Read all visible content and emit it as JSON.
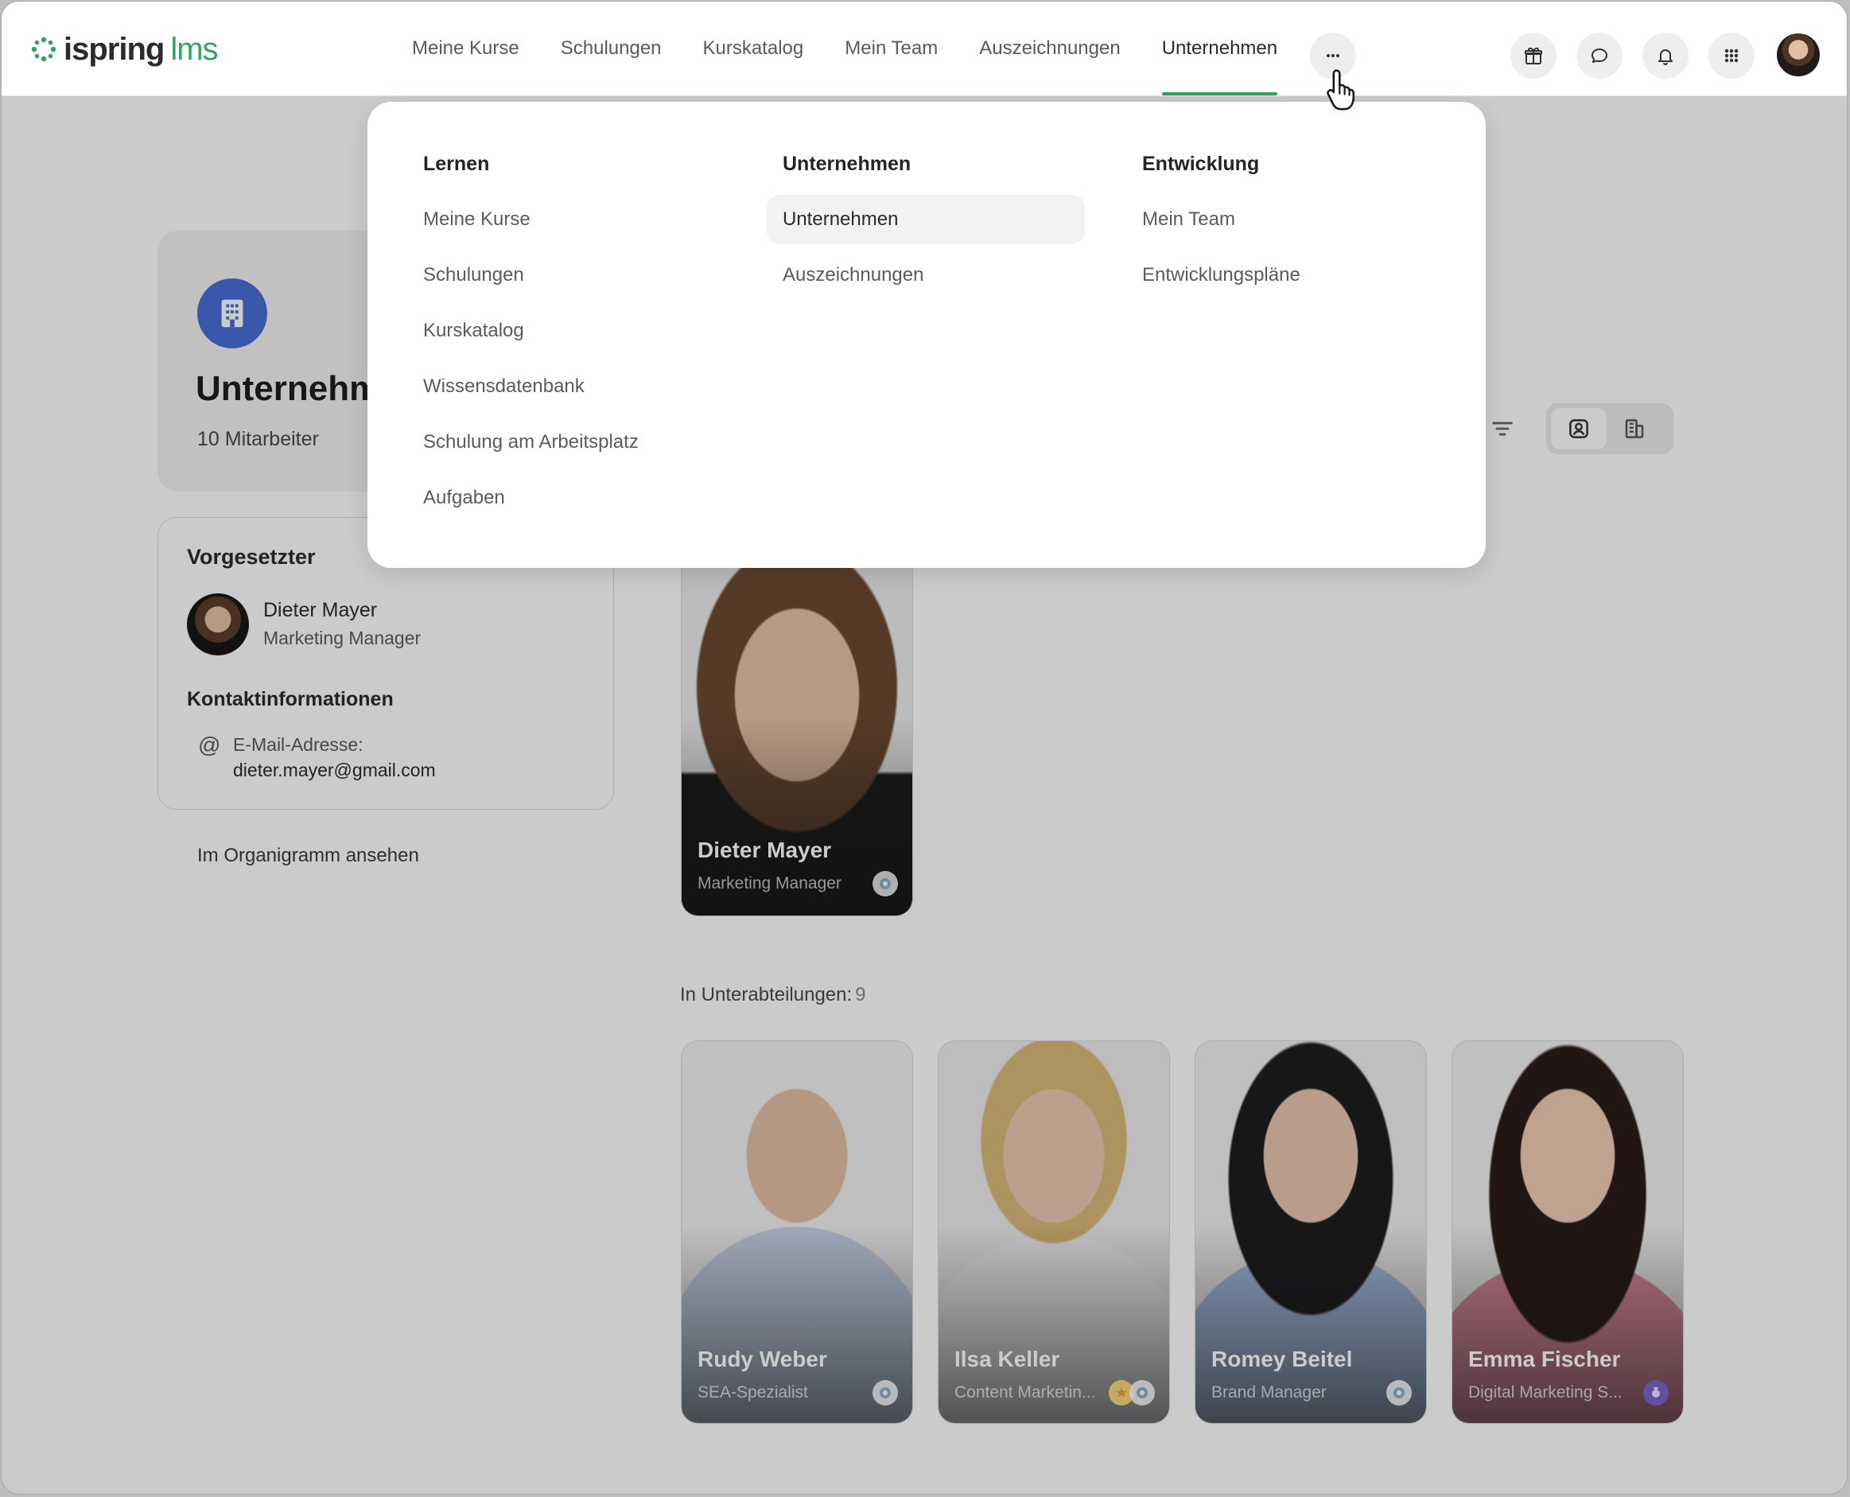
{
  "app": {
    "logo_name": "ispring",
    "logo_suffix": "lms",
    "brand_color": "#31a460"
  },
  "nav": {
    "items": [
      {
        "label": "Meine Kurse"
      },
      {
        "label": "Schulungen"
      },
      {
        "label": "Kurskatalog"
      },
      {
        "label": "Mein Team"
      },
      {
        "label": "Auszeichnungen"
      },
      {
        "label": "Unternehmen",
        "active": true
      }
    ],
    "more_icon": "more-horizontal-icon",
    "right_icons": [
      "gift-icon",
      "chat-icon",
      "bell-icon",
      "apps-grid-icon"
    ]
  },
  "org": {
    "title": "Unternehmen",
    "employee_count": "10 Mitarbeiter",
    "icon": "building-icon"
  },
  "supervisor": {
    "section_title": "Vorgesetzter",
    "name": "Dieter Mayer",
    "role": "Marketing Manager",
    "contact_title": "Kontaktinformationen",
    "email_label": "E-Mail-Adresse:",
    "email": "dieter.mayer@gmail.com",
    "org_chart_link": "Im Organigramm ansehen"
  },
  "head_card": {
    "name": "Dieter Mayer",
    "role": "Marketing Manager"
  },
  "subdepartments": {
    "label": "In Unterabteilungen:",
    "count": "9",
    "cards": [
      {
        "name": "Rudy Weber",
        "role": "SEA-Spezialist"
      },
      {
        "name": "Ilsa Keller",
        "role": "Content Marketin..."
      },
      {
        "name": "Romey Beitel",
        "role": "Brand Manager"
      },
      {
        "name": "Emma Fischer",
        "role": "Digital Marketing S..."
      }
    ]
  },
  "dropdown": {
    "columns": [
      {
        "heading": "Lernen",
        "items": [
          "Meine Kurse",
          "Schulungen",
          "Kurskatalog",
          "Wissensdatenbank",
          "Schulung am Arbeitsplatz",
          "Aufgaben"
        ]
      },
      {
        "heading": "Unternehmen",
        "items": [
          "Unternehmen",
          "Auszeichnungen"
        ],
        "selected": "Unternehmen"
      },
      {
        "heading": "Entwicklung",
        "items": [
          "Mein Team",
          "Entwicklungspläne"
        ]
      }
    ]
  }
}
